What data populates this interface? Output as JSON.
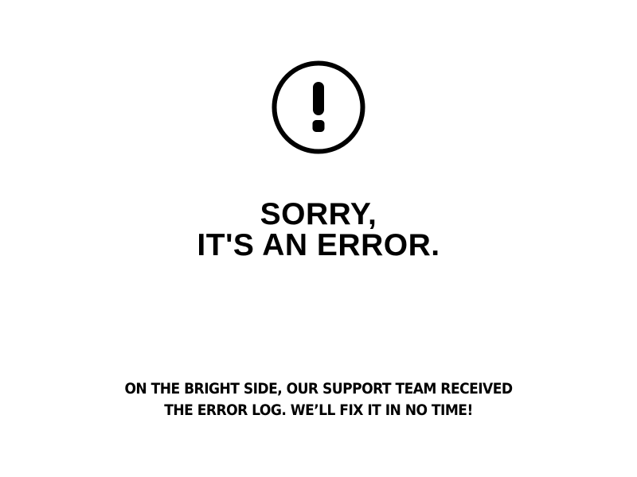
{
  "error_icon": "exclamation-circle-icon",
  "colors": {
    "background": "#ffffff",
    "text": "#000000"
  },
  "heading": {
    "line1": "SORRY,",
    "line2": "IT'S AN ERROR."
  },
  "message": {
    "line1": "ON THE BRIGHT SIDE, OUR SUPPORT TEAM RECEIVED",
    "line2": "THE ERROR LOG. WE’LL FIX IT IN NO TIME!"
  }
}
